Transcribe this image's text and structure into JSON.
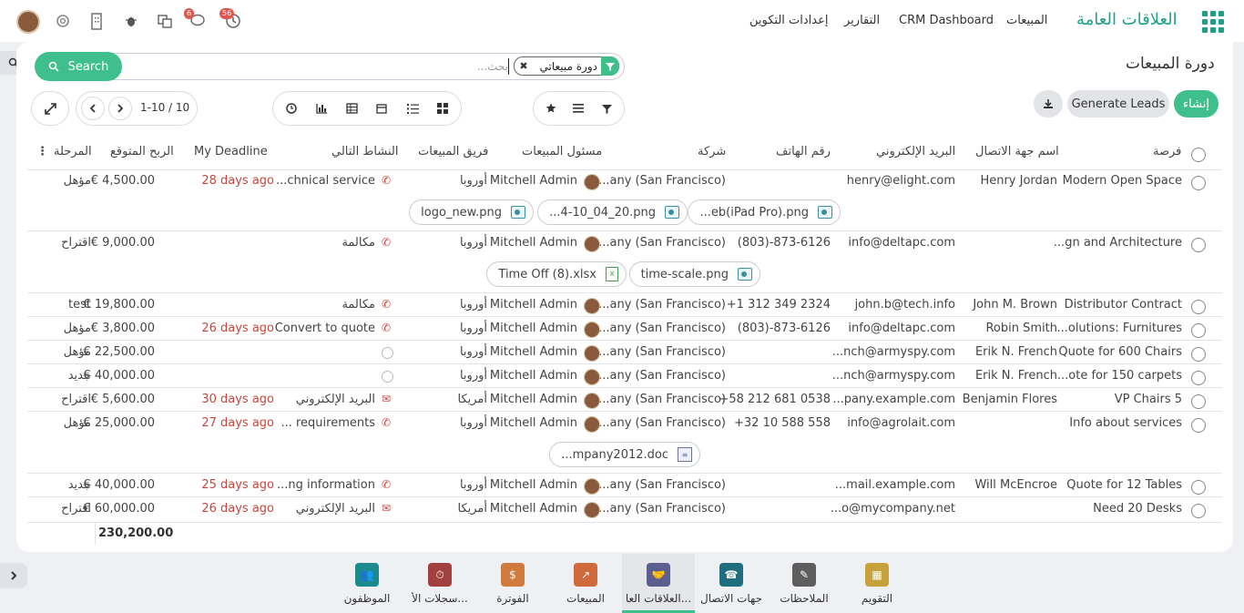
{
  "topbar": {
    "brand": "العلاقات العامة",
    "menu": [
      "المبيعات",
      "CRM Dashboard",
      "التقارير",
      "إعدادات التكوين"
    ],
    "badge_messages": "6",
    "badge_activities": "56"
  },
  "page": {
    "title": "دورة المبيعات",
    "search_placeholder": "بحث...",
    "facet": "دورة مبيعاتي",
    "search_button": "Search",
    "create_button": "إنشاء",
    "generate_leads_button": "Generate Leads",
    "pager": "1-10 / 10"
  },
  "columns": {
    "opportunity": "فرصة",
    "contact": "اسم جهة الاتصال",
    "email": "البريد الإلكتروني",
    "phone": "رقم الهاتف",
    "company": "شركة",
    "salesperson": "مسئول المبيعات",
    "team": "فريق المبيعات",
    "next_activity": "النشاط التالي",
    "deadline": "My Deadline",
    "revenue": "الربح المتوقع",
    "stage": "المرحلة"
  },
  "rows": [
    {
      "opportunity": "Modern Open Space",
      "contact": "Henry Jordan",
      "email": "henry@elight.com",
      "phone": "",
      "company": "...any (San Francisco)",
      "salesperson": "Mitchell Admin",
      "team": "أوروبا",
      "activity": "...chnical service",
      "deadline": "28 days ago",
      "revenue": "€ 4,500.00",
      "stage": "مؤهل"
    },
    {
      "opportunity": "...gn and Architecture",
      "contact": "",
      "email": "info@deltapc.com",
      "phone": "(803)-873-6126",
      "company": "...any (San Francisco)",
      "salesperson": "Mitchell Admin",
      "team": "أوروبا",
      "activity": "مكالمة",
      "deadline": "",
      "revenue": "€ 9,000.00",
      "stage": "اقتراح"
    },
    {
      "opportunity": "Distributor Contract",
      "contact": "John M. Brown",
      "email": "john.b@tech.info",
      "phone": "+1 312 349 2324",
      "company": "...any (San Francisco)",
      "salesperson": "Mitchell Admin",
      "team": "أوروبا",
      "activity": "مكالمة",
      "deadline": "",
      "revenue": "€ 19,800.00",
      "stage": "test"
    },
    {
      "opportunity": "...olutions: Furnitures",
      "contact": "Robin Smith",
      "email": "info@deltapc.com",
      "phone": "(803)-873-6126",
      "company": "...any (San Francisco)",
      "salesperson": "Mitchell Admin",
      "team": "أوروبا",
      "activity": "Convert to quote",
      "deadline": "26 days ago",
      "revenue": "€ 3,800.00",
      "stage": "مؤهل"
    },
    {
      "opportunity": "Quote for 600 Chairs",
      "contact": "Erik N. French",
      "email": "...nch@armyspy.com",
      "phone": "",
      "company": "...any (San Francisco)",
      "salesperson": "Mitchell Admin",
      "team": "أوروبا",
      "activity": "",
      "deadline": "",
      "revenue": "€ 22,500.00",
      "stage": "مؤهل"
    },
    {
      "opportunity": "...ote for 150 carpets",
      "contact": "Erik N. French",
      "email": "...nch@armyspy.com",
      "phone": "",
      "company": "...any (San Francisco)",
      "salesperson": "Mitchell Admin",
      "team": "أوروبا",
      "activity": "",
      "deadline": "",
      "revenue": "€ 40,000.00",
      "stage": "جديد"
    },
    {
      "opportunity": "VP Chairs 5",
      "contact": "Benjamin Flores",
      "email": "...pany.example.com",
      "phone": "+58 212 681 0538",
      "company": "...any (San Francisco)",
      "salesperson": "Mitchell Admin",
      "team": "أمريكا",
      "activity": "البريد الإلكتروني",
      "deadline": "30 days ago",
      "revenue": "€ 5,600.00",
      "stage": "اقتراح"
    },
    {
      "opportunity": "Info about services",
      "contact": "",
      "email": "info@agrolait.com",
      "phone": "+32 10 588 558",
      "company": "...any (San Francisco)",
      "salesperson": "Mitchell Admin",
      "team": "أوروبا",
      "activity": "... requirements",
      "deadline": "27 days ago",
      "revenue": "€ 25,000.00",
      "stage": "مؤهل"
    },
    {
      "opportunity": "Quote for 12 Tables",
      "contact": "Will McEncroe",
      "email": "...mail.example.com",
      "phone": "",
      "company": "...any (San Francisco)",
      "salesperson": "Mitchell Admin",
      "team": "أوروبا",
      "activity": "...ng information",
      "deadline": "25 days ago",
      "revenue": "€ 40,000.00",
      "stage": "جديد"
    },
    {
      "opportunity": "Need 20 Desks",
      "contact": "",
      "email": "...o@mycompany.net",
      "phone": "",
      "company": "...any (San Francisco)",
      "salesperson": "Mitchell Admin",
      "team": "أمريكا",
      "activity": "البريد الإلكتروني",
      "deadline": "26 days ago",
      "revenue": "€ 60,000.00",
      "stage": "اقتراح"
    }
  ],
  "attachments": {
    "row1": [
      "logo_new.png",
      "...4-10_04_20.png",
      "...eb(iPad Pro).png"
    ],
    "row2": [
      "Time Off (8).xlsx",
      "time-scale.png"
    ],
    "row8": [
      "...mpany2012.doc"
    ]
  },
  "total_revenue": "230,200.00",
  "dock": [
    "الموظفون",
    "سجلات الأ...",
    "الفوترة",
    "المبيعات",
    "العلاقات العا...",
    "جهات الاتصال",
    "الملاحظات",
    "التقويم"
  ],
  "colors": {
    "accent": "#3fbf8c",
    "brand": "#1f9e8b",
    "overdue": "#c9463d"
  }
}
